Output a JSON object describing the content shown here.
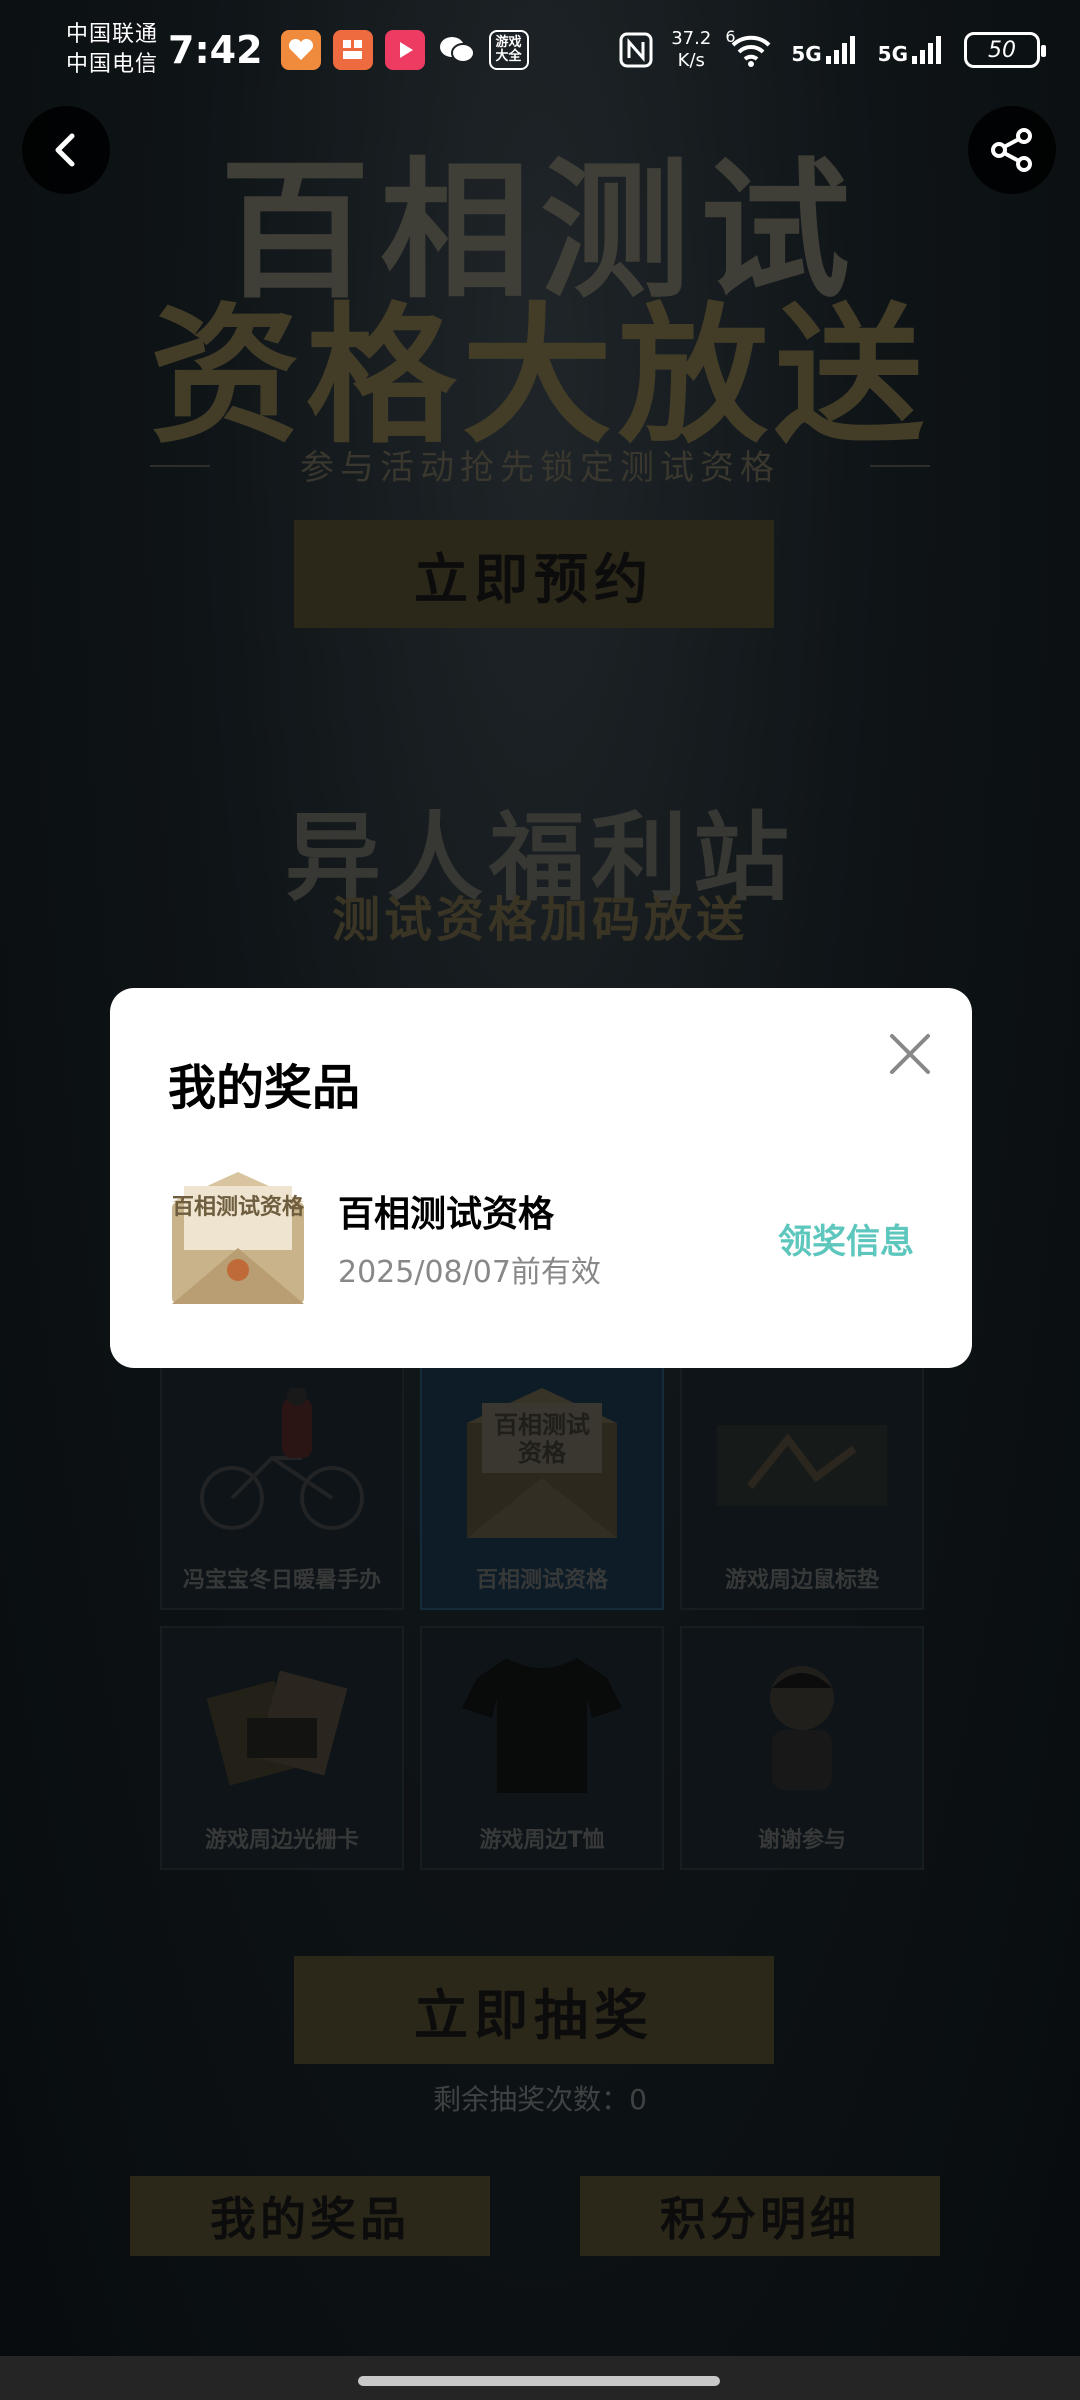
{
  "status_bar": {
    "carrier1": "中国联通",
    "carrier2": "中国电信",
    "time": "7:42",
    "app_icon_label": "游戏大全",
    "net_speed_value": "37.2",
    "net_speed_unit": "K/s",
    "wifi_label": "6",
    "sig1": "5G",
    "sig2": "5G",
    "battery": "50"
  },
  "hero": {
    "title_line1": "百相测试",
    "title_line2": "资格大放送",
    "subtitle": "参与活动抢先锁定测试资格",
    "reserve_label": "立即预约"
  },
  "welfare": {
    "title": "异人福利站",
    "subtitle": "测试资格加码放送"
  },
  "prize_grid": [
    {
      "label": "冯宝宝冬日暖暑手办",
      "active": false
    },
    {
      "label": "百相测试资格",
      "active": true
    },
    {
      "label": "游戏周边鼠标垫",
      "active": false
    },
    {
      "label": "游戏周边光栅卡",
      "active": false
    },
    {
      "label": "游戏周边T恤",
      "active": false
    },
    {
      "label": "谢谢参与",
      "active": false
    }
  ],
  "envelope_art_text": "百相测试资格",
  "draw": {
    "draw_label": "立即抽奖",
    "remaining_label": "剩余抽奖次数：0"
  },
  "bottom_buttons": {
    "my_prizes": "我的奖品",
    "points_detail": "积分明细"
  },
  "modal": {
    "title": "我的奖品",
    "prize_name": "百相测试资格",
    "prize_expiry": "2025/08/07前有效",
    "claim_label": "领奖信息",
    "envelope_text": "百相测试资格"
  },
  "colors": {
    "accent": "#5dc7bd",
    "gold_button": "#3a3522"
  }
}
